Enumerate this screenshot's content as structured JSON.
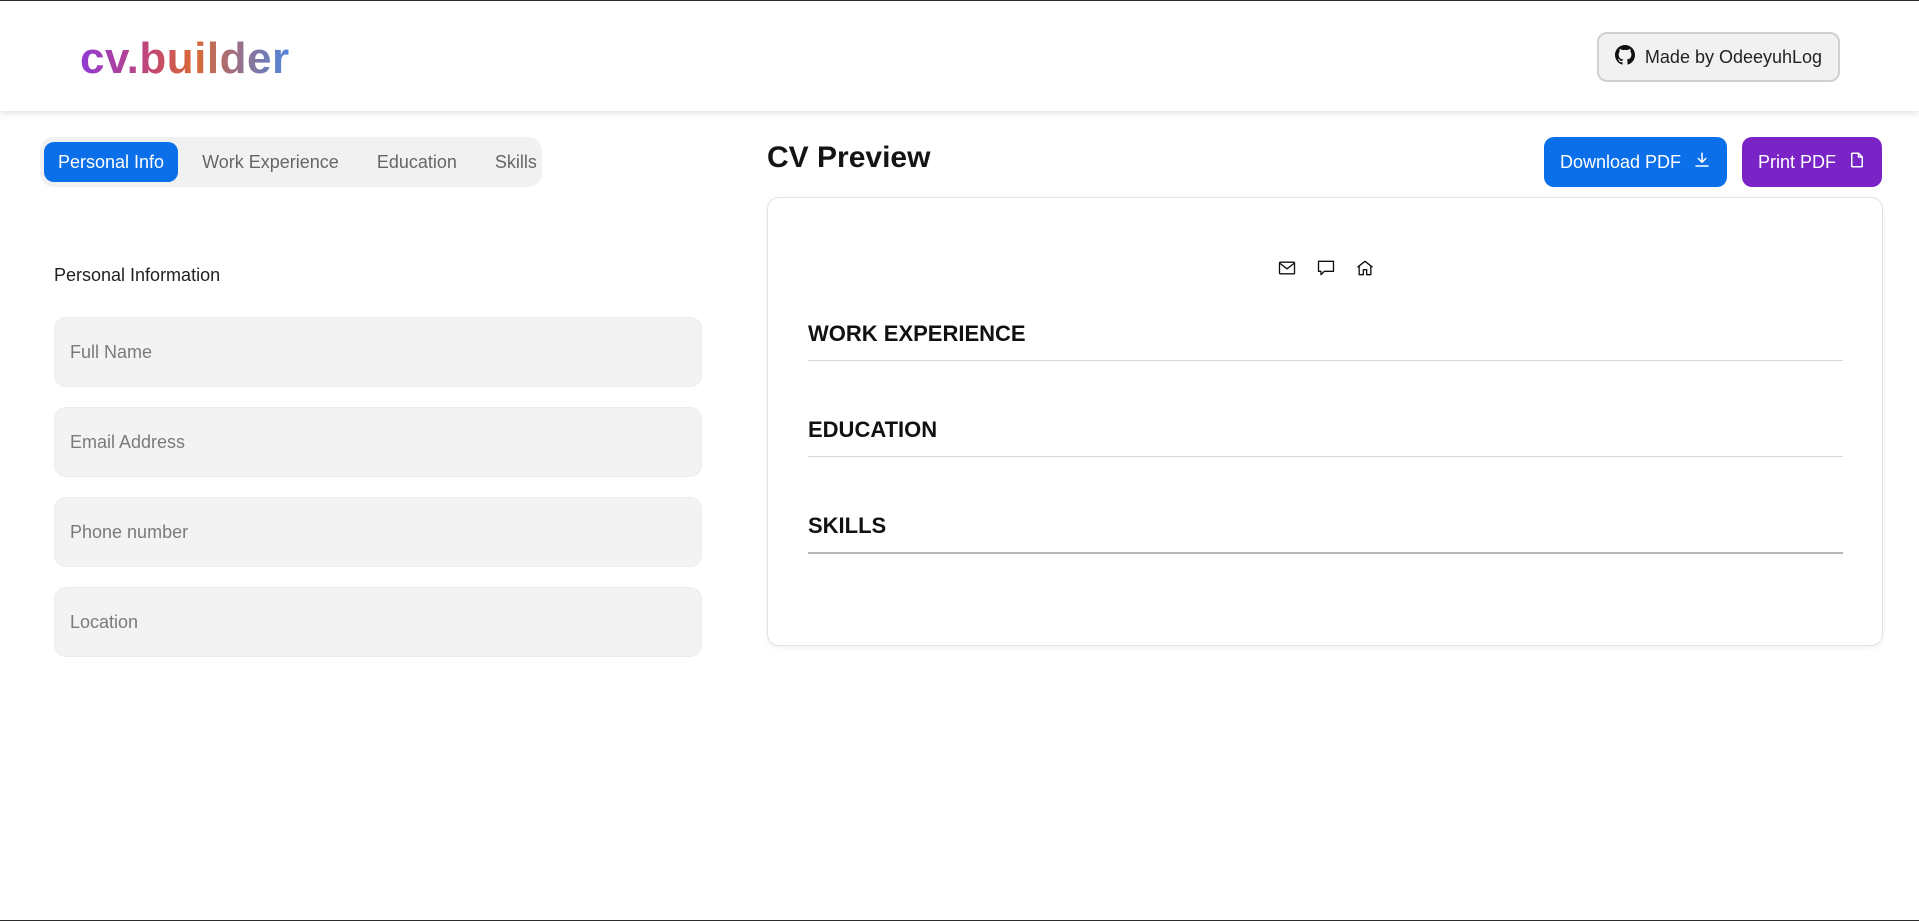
{
  "header": {
    "logo": "cv.builder",
    "made_by_label": "Made by OdeeyuhLog",
    "made_by_icon": "github-icon"
  },
  "tabs": [
    {
      "label": "Personal Info",
      "active": true
    },
    {
      "label": "Work Experience",
      "active": false
    },
    {
      "label": "Education",
      "active": false
    },
    {
      "label": "Skills",
      "active": false
    }
  ],
  "form": {
    "section_label": "Personal Information",
    "fields": [
      {
        "placeholder": "Full Name",
        "value": ""
      },
      {
        "placeholder": "Email Address",
        "value": ""
      },
      {
        "placeholder": "Phone number",
        "value": ""
      },
      {
        "placeholder": "Location",
        "value": ""
      }
    ]
  },
  "preview": {
    "title": "CV Preview",
    "download_label": "Download PDF",
    "download_icon": "download-icon",
    "print_label": "Print PDF",
    "print_icon": "file-icon",
    "contact_icons": [
      "mail-icon",
      "message-icon",
      "home-icon"
    ],
    "sections": [
      "WORK EXPERIENCE",
      "EDUCATION",
      "SKILLS"
    ]
  },
  "colors": {
    "primary": "#0a6fe8",
    "print_button": "#7a24c8",
    "field_bg": "#f3f3f3",
    "tab_bar_bg": "#f1f1f1"
  }
}
